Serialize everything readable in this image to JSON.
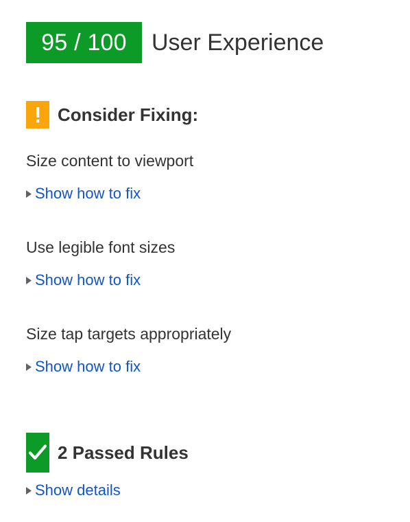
{
  "report": {
    "score": {
      "value": "95 / 100",
      "title": "User Experience",
      "badge_color": "#0d9b27",
      "badge_text_color": "#ffffff"
    },
    "consider_fixing": {
      "icon": "warning-exclamation-icon",
      "icon_color": "#f9a50b",
      "label": "Consider Fixing:",
      "rules": [
        {
          "title": "Size content to viewport",
          "link_label": "Show how to fix",
          "marker": "disclosure-triangle-right-icon"
        },
        {
          "title": "Use legible font sizes",
          "link_label": "Show how to fix",
          "marker": "disclosure-triangle-right-icon"
        },
        {
          "title": "Size tap targets appropriately",
          "link_label": "Show how to fix",
          "marker": "disclosure-triangle-right-icon"
        }
      ]
    },
    "passed_rules": {
      "icon": "check-mark-icon",
      "icon_color": "#0d9b27",
      "label": "2 Passed Rules",
      "count": 2,
      "link_label": "Show details",
      "marker": "disclosure-triangle-right-icon"
    },
    "colors": {
      "link": "#1155cc",
      "text": "#333333",
      "background": "#ffffff"
    }
  }
}
